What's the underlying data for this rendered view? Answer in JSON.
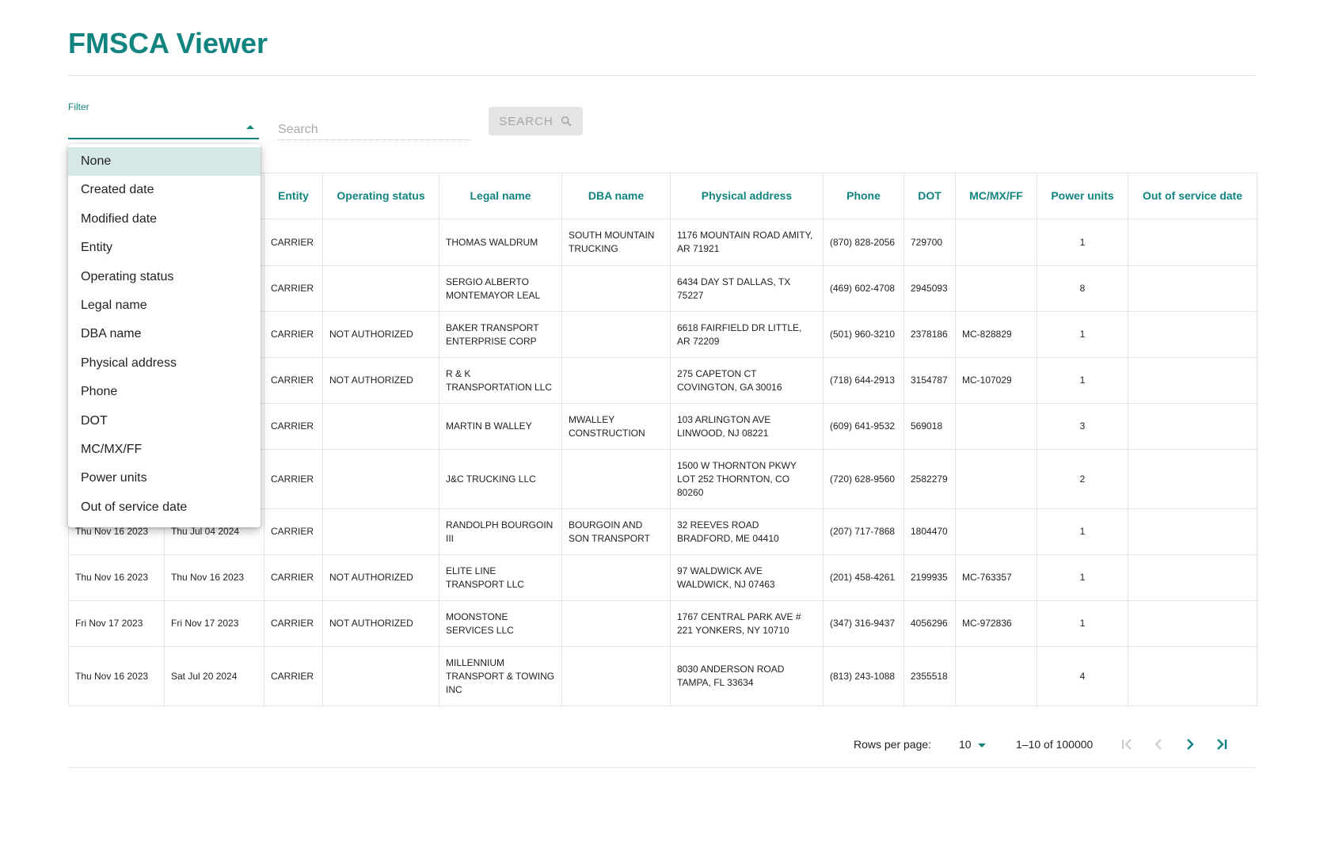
{
  "app": {
    "title": "FMSCA Viewer"
  },
  "filter": {
    "label": "Filter",
    "options": [
      "None",
      "Created date",
      "Modified date",
      "Entity",
      "Operating status",
      "Legal name",
      "DBA name",
      "Physical address",
      "Phone",
      "DOT",
      "MC/MX/FF",
      "Power units",
      "Out of service date"
    ]
  },
  "search": {
    "placeholder": "Search",
    "button_label": "SEARCH"
  },
  "table": {
    "headers": [
      "Created date",
      "Modified date",
      "Entity",
      "Operating status",
      "Legal name",
      "DBA name",
      "Physical address",
      "Phone",
      "DOT",
      "MC/MX/FF",
      "Power units",
      "Out of service date"
    ],
    "rows": [
      [
        "",
        "",
        "CARRIER",
        "",
        "THOMAS WALDRUM",
        "SOUTH MOUNTAIN TRUCKING",
        "1176 MOUNTAIN ROAD AMITY, AR 71921",
        "(870) 828-2056",
        "729700",
        "",
        "1",
        ""
      ],
      [
        "",
        "",
        "CARRIER",
        "",
        "SERGIO ALBERTO MONTEMAYOR LEAL",
        "",
        "6434 DAY ST DALLAS, TX 75227",
        "(469) 602-4708",
        "2945093",
        "",
        "8",
        ""
      ],
      [
        "",
        "",
        "CARRIER",
        "NOT AUTHORIZED",
        "BAKER TRANSPORT ENTERPRISE CORP",
        "",
        "6618 FAIRFIELD DR LITTLE, AR 72209",
        "(501) 960-3210",
        "2378186",
        "MC-828829",
        "1",
        ""
      ],
      [
        "",
        "",
        "CARRIER",
        "NOT AUTHORIZED",
        "R & K TRANSPORTATION LLC",
        "",
        "275 CAPETON CT COVINGTON, GA 30016",
        "(718) 644-2913",
        "3154787",
        "MC-107029",
        "1",
        ""
      ],
      [
        "",
        "",
        "CARRIER",
        "",
        "MARTIN B WALLEY",
        "MWALLEY CONSTRUCTION",
        "103 ARLINGTON AVE LINWOOD, NJ 08221",
        "(609) 641-9532",
        "569018",
        "",
        "3",
        ""
      ],
      [
        "",
        "",
        "CARRIER",
        "",
        "J&C TRUCKING LLC",
        "",
        "1500 W THORNTON PKWY LOT 252 THORNTON, CO 80260",
        "(720) 628-9560",
        "2582279",
        "",
        "2",
        ""
      ],
      [
        "Thu Nov 16 2023",
        "Thu Jul 04 2024",
        "CARRIER",
        "",
        "RANDOLPH BOURGOIN III",
        "BOURGOIN AND SON TRANSPORT",
        "32 REEVES ROAD BRADFORD, ME 04410",
        "(207) 717-7868",
        "1804470",
        "",
        "1",
        ""
      ],
      [
        "Thu Nov 16 2023",
        "Thu Nov 16 2023",
        "CARRIER",
        "NOT AUTHORIZED",
        "ELITE LINE TRANSPORT LLC",
        "",
        "97 WALDWICK AVE WALDWICK, NJ 07463",
        "(201) 458-4261",
        "2199935",
        "MC-763357",
        "1",
        ""
      ],
      [
        "Fri Nov 17 2023",
        "Fri Nov 17 2023",
        "CARRIER",
        "NOT AUTHORIZED",
        "MOONSTONE SERVICES LLC",
        "",
        "1767 CENTRAL PARK AVE # 221 YONKERS, NY 10710",
        "(347) 316-9437",
        "4056296",
        "MC-972836",
        "1",
        ""
      ],
      [
        "Thu Nov 16 2023",
        "Sat Jul 20 2024",
        "CARRIER",
        "",
        "MILLENNIUM TRANSPORT & TOWING INC",
        "",
        "8030 ANDERSON ROAD TAMPA, FL 33634",
        "(813) 243-1088",
        "2355518",
        "",
        "4",
        ""
      ]
    ]
  },
  "pagination": {
    "rows_per_page_label": "Rows per page:",
    "rows_per_page": "10",
    "range_text": "1–10 of 100000"
  },
  "colors": {
    "accent": "#11847f",
    "selected_option_bg": "#d5e8e6"
  }
}
